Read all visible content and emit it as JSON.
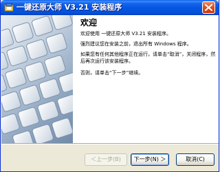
{
  "window": {
    "title": "一键还原大师 V3.21 安装程序"
  },
  "content": {
    "heading": "欢迎",
    "paragraphs": [
      "欢迎使用 一键还原大师 V3.21  安装程序。",
      "强烈建议您在安装之前，退出所有 Windows 程序。",
      "如果您有任何其他程序正在运行，请单击“取消”，关闭程序，然后再次运行该安装程序。",
      "否则，请单击“下一步”继续。"
    ]
  },
  "buttons": {
    "back": "＜上一步(B)",
    "next": "下一步(N) ＞",
    "cancel": "取消(C)"
  },
  "icons": {
    "app": "installer-icon",
    "close": "close-icon",
    "keyboard": "keyboard-illustration"
  },
  "colors": {
    "titlebar": "#0454e1",
    "close": "#d9531f",
    "dialog_bg": "#ece9d8"
  }
}
